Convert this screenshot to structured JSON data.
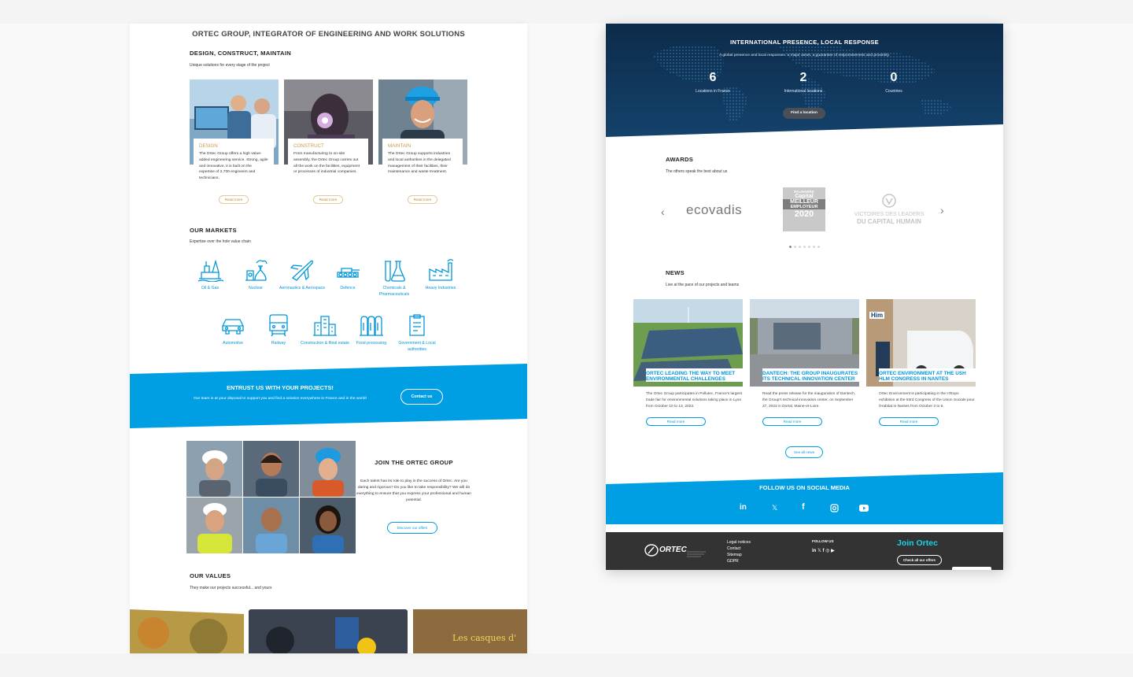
{
  "left": {
    "title": "ORTEC GROUP, INTEGRATOR OF ENGINEERING AND WORK SOLUTIONS",
    "design_section": {
      "heading": "DESIGN, CONSTRUCT, MAINTAIN",
      "subtitle": "Unique solutions for every stage of the project",
      "cards": [
        {
          "title": "DESIGN",
          "text": "The Ortec Group offers a high value-added engineering service. Strong, agile and innovative, it is built on the expertise of 2,700 engineers and technicians.",
          "button": "Read more"
        },
        {
          "title": "CONSTRUCT",
          "text": "From manufacturing to on-site assembly, the Ortec Group carries out all the work on the facilities, equipment or processes of industrial companies.",
          "button": "Read more"
        },
        {
          "title": "MAINTAIN",
          "text": "The Ortec Group supports industries and local authorities in the delegated management of their facilities, their maintenance and waste treatment.",
          "button": "Read more"
        }
      ]
    },
    "markets": {
      "heading": "OUR MARKETS",
      "subtitle": "Expertise over the hole value chain",
      "items": [
        "Oil & Gas",
        "Nuclear",
        "Aeronautics & Aerospace",
        "Defence",
        "Chemicals & Pharmaceuticals",
        "Heavy Industries",
        "Automotive",
        "Railway",
        "Construction & Real estate",
        "Food processing",
        "Government & Local authorities"
      ],
      "icons": [
        "oil-rig-icon",
        "nuclear-plant-icon",
        "airplane-icon",
        "tank-icon",
        "flask-icon",
        "factory-icon",
        "car-icon",
        "train-icon",
        "buildings-icon",
        "silos-icon",
        "document-icon"
      ]
    },
    "entrust": {
      "heading": "ENTRUST US WITH YOUR PROJECTS!",
      "text": "Our team is at your disposal to support you and find a solution everywhere in France and in the world!",
      "button": "Contact us"
    },
    "join": {
      "heading": "JOIN THE ORTEC GROUP",
      "text": "Each talent has its role to play in the success of Ortec. Are you daring and rigorous? Do you like to take responsibility? We will do everything to ensure that you express your professional and human potential.",
      "button": "Discover our offers"
    },
    "values": {
      "heading": "OUR VALUES",
      "subtitle": "They make our projects successful... and yours",
      "image_text": "Les casques d'"
    }
  },
  "right": {
    "presence": {
      "heading": "INTERNATIONAL PRESENCE, LOCAL RESPONSE",
      "subtitle": "A global presence and local responses: a major asset, a guarantee of responsiveness and proximity.",
      "stats": [
        {
          "value": "6",
          "label": "Locations in France"
        },
        {
          "value": "2",
          "label": "International locations"
        },
        {
          "value": "0",
          "label": "Countries"
        }
      ],
      "button": "Find a location"
    },
    "awards": {
      "heading": "AWARDS",
      "subtitle": "The others speak the best about us",
      "logos": {
        "ecovadis": "ecovadis",
        "palmares_lines": [
          "PALMARÈS",
          "Capital",
          "MEILLEUR",
          "EMPLOYEUR",
          "2020"
        ],
        "victoires_lines": [
          "VICTOIRES DES LEADERS",
          "DU CAPITAL HUMAIN"
        ]
      },
      "prev_icon": "chevron-left-icon",
      "next_icon": "chevron-right-icon"
    },
    "news": {
      "heading": "NEWS",
      "subtitle": "Live at the pace of our projects and teams",
      "items": [
        {
          "title": "ORTEC LEADING THE WAY TO MEET ENVIRONMENTAL CHALLENGES",
          "text": "The Ortec Group participates in Pollutec, France's largest trade fair for environmental solutions taking place in Lyon from October 10 to 13, 2023.",
          "button": "Read more"
        },
        {
          "title": "DANTECH: THE GROUP INAUGURATES ITS TECHNICAL INNOVATION CENTER",
          "text": "Read the press release for the inauguration of Dantech, the Group's technical innovation center, on September 27, 2023 in Dortal, Maine-et-Loire.",
          "button": "Read more"
        },
        {
          "title": "ORTEC ENVIRONMENT AT THE USH HLM CONGRESS IN NANTES",
          "text": "Ortec Environment is participating in the H'Expo exhibition at the 83rd Congress of the Union Sociale pour l'Habitat in Nantes from October 3 to 5.",
          "button": "Read more"
        }
      ],
      "news3_badge": "Him",
      "see_all": "See all news"
    },
    "social": {
      "heading": "FOLLOW US ON SOCIAL MEDIA",
      "icons": [
        "linkedin-icon",
        "x-icon",
        "facebook-icon",
        "instagram-icon",
        "youtube-icon"
      ]
    },
    "footer": {
      "logo_text": "ORTEC",
      "links": [
        "Legal notices",
        "Contact",
        "Sitemap",
        "GDPR"
      ],
      "follow_label": "FOLLOW US",
      "join_heading": "Join Ortec",
      "join_button": "Check all our offers"
    }
  },
  "colors": {
    "brand_blue": "#009ee3",
    "gold": "#c99a4a",
    "footer": "#333333",
    "join_cyan": "#19d3e8"
  }
}
